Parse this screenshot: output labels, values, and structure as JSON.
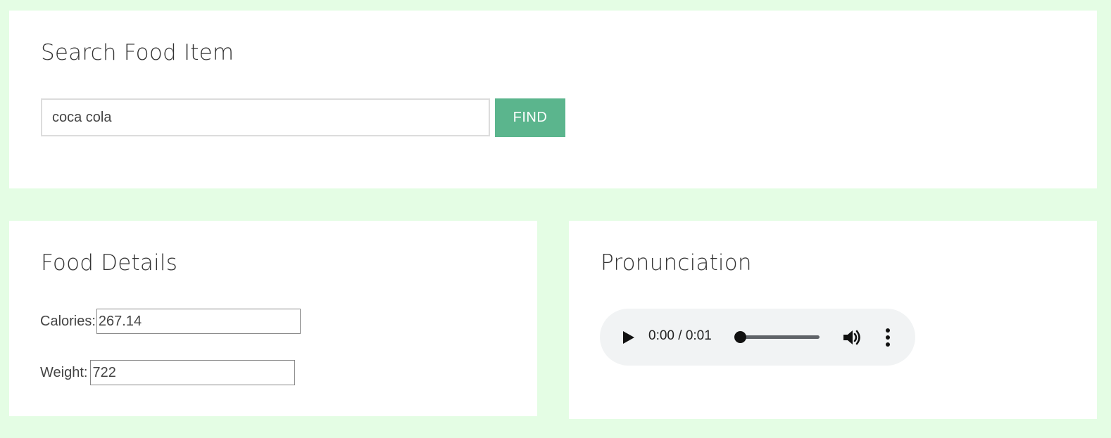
{
  "search": {
    "title": "Search Food Item",
    "input_value": "coca cola",
    "find_label": "FIND"
  },
  "food_details": {
    "title": "Food Details",
    "calories_label": "Calories:",
    "calories_value": "267.14",
    "weight_label": "Weight:",
    "weight_value": "722"
  },
  "pronunciation": {
    "title": "Pronunciation",
    "time_display": "0:00 / 0:01",
    "playback_progress": 0,
    "icons": [
      "play-icon",
      "volume-icon",
      "more-options-icon"
    ]
  },
  "colors": {
    "background": "#e4fde4",
    "panel": "#ffffff",
    "accent_button": "#5bb58d",
    "audio_player_bg": "#f1f3f4"
  }
}
